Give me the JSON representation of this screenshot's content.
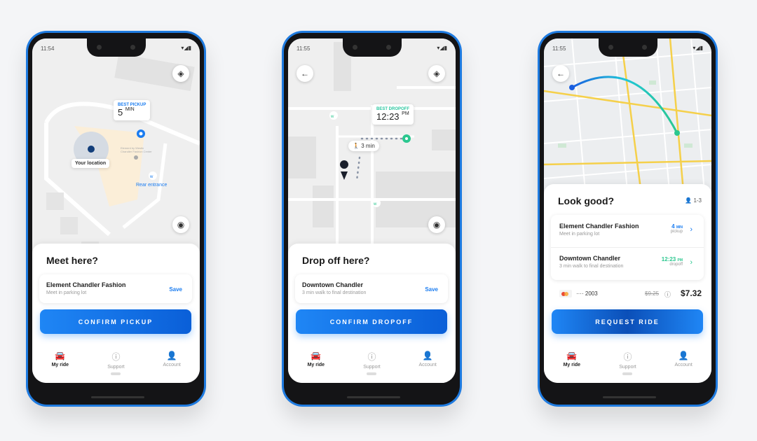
{
  "colors": {
    "accent": "#1a7cf0",
    "green": "#2bc7a0",
    "frame": "#1f7be0"
  },
  "nav": [
    {
      "label": "My ride",
      "icon": "car-icon"
    },
    {
      "label": "Support",
      "icon": "help-icon"
    },
    {
      "label": "Account",
      "icon": "account-icon"
    }
  ],
  "phone1": {
    "time": "11:54",
    "map": {
      "pickup_label": "BEST PICKUP",
      "pickup_value": "5",
      "pickup_unit": "MIN",
      "your_location": "Your location",
      "poi": "Element by Westin Chandler Fashion Center",
      "rear_entrance": "Rear entrance"
    },
    "title": "Meet here?",
    "card": {
      "name": "Element Chandler Fashion",
      "sub": "Meet in parking lot",
      "save": "Save"
    },
    "button": "CONFIRM PICKUP"
  },
  "phone2": {
    "time": "11:55",
    "map": {
      "dropoff_label": "BEST DROPOFF",
      "dropoff_value": "12:23",
      "dropoff_unit": "PM",
      "walk": "3 min"
    },
    "title": "Drop off here?",
    "card": {
      "name": "Downtown Chandler",
      "sub": "3 min walk to final destination",
      "save": "Save"
    },
    "button": "CONFIRM DROPOFF"
  },
  "phone3": {
    "time": "11:55",
    "title": "Look good?",
    "passengers": "1-3",
    "rows": [
      {
        "name": "Element Chandler Fashion",
        "sub": "Meet in parking lot",
        "value": "4",
        "unit": "MIN",
        "label": "pickup"
      },
      {
        "name": "Downtown Chandler",
        "sub": "3 min walk to final destination",
        "value": "12:23",
        "unit": "PM",
        "label": "dropoff"
      }
    ],
    "payment": {
      "card": "···· 2003",
      "old_price": "$9.25",
      "price": "$7.32"
    },
    "button": "REQUEST RIDE"
  }
}
